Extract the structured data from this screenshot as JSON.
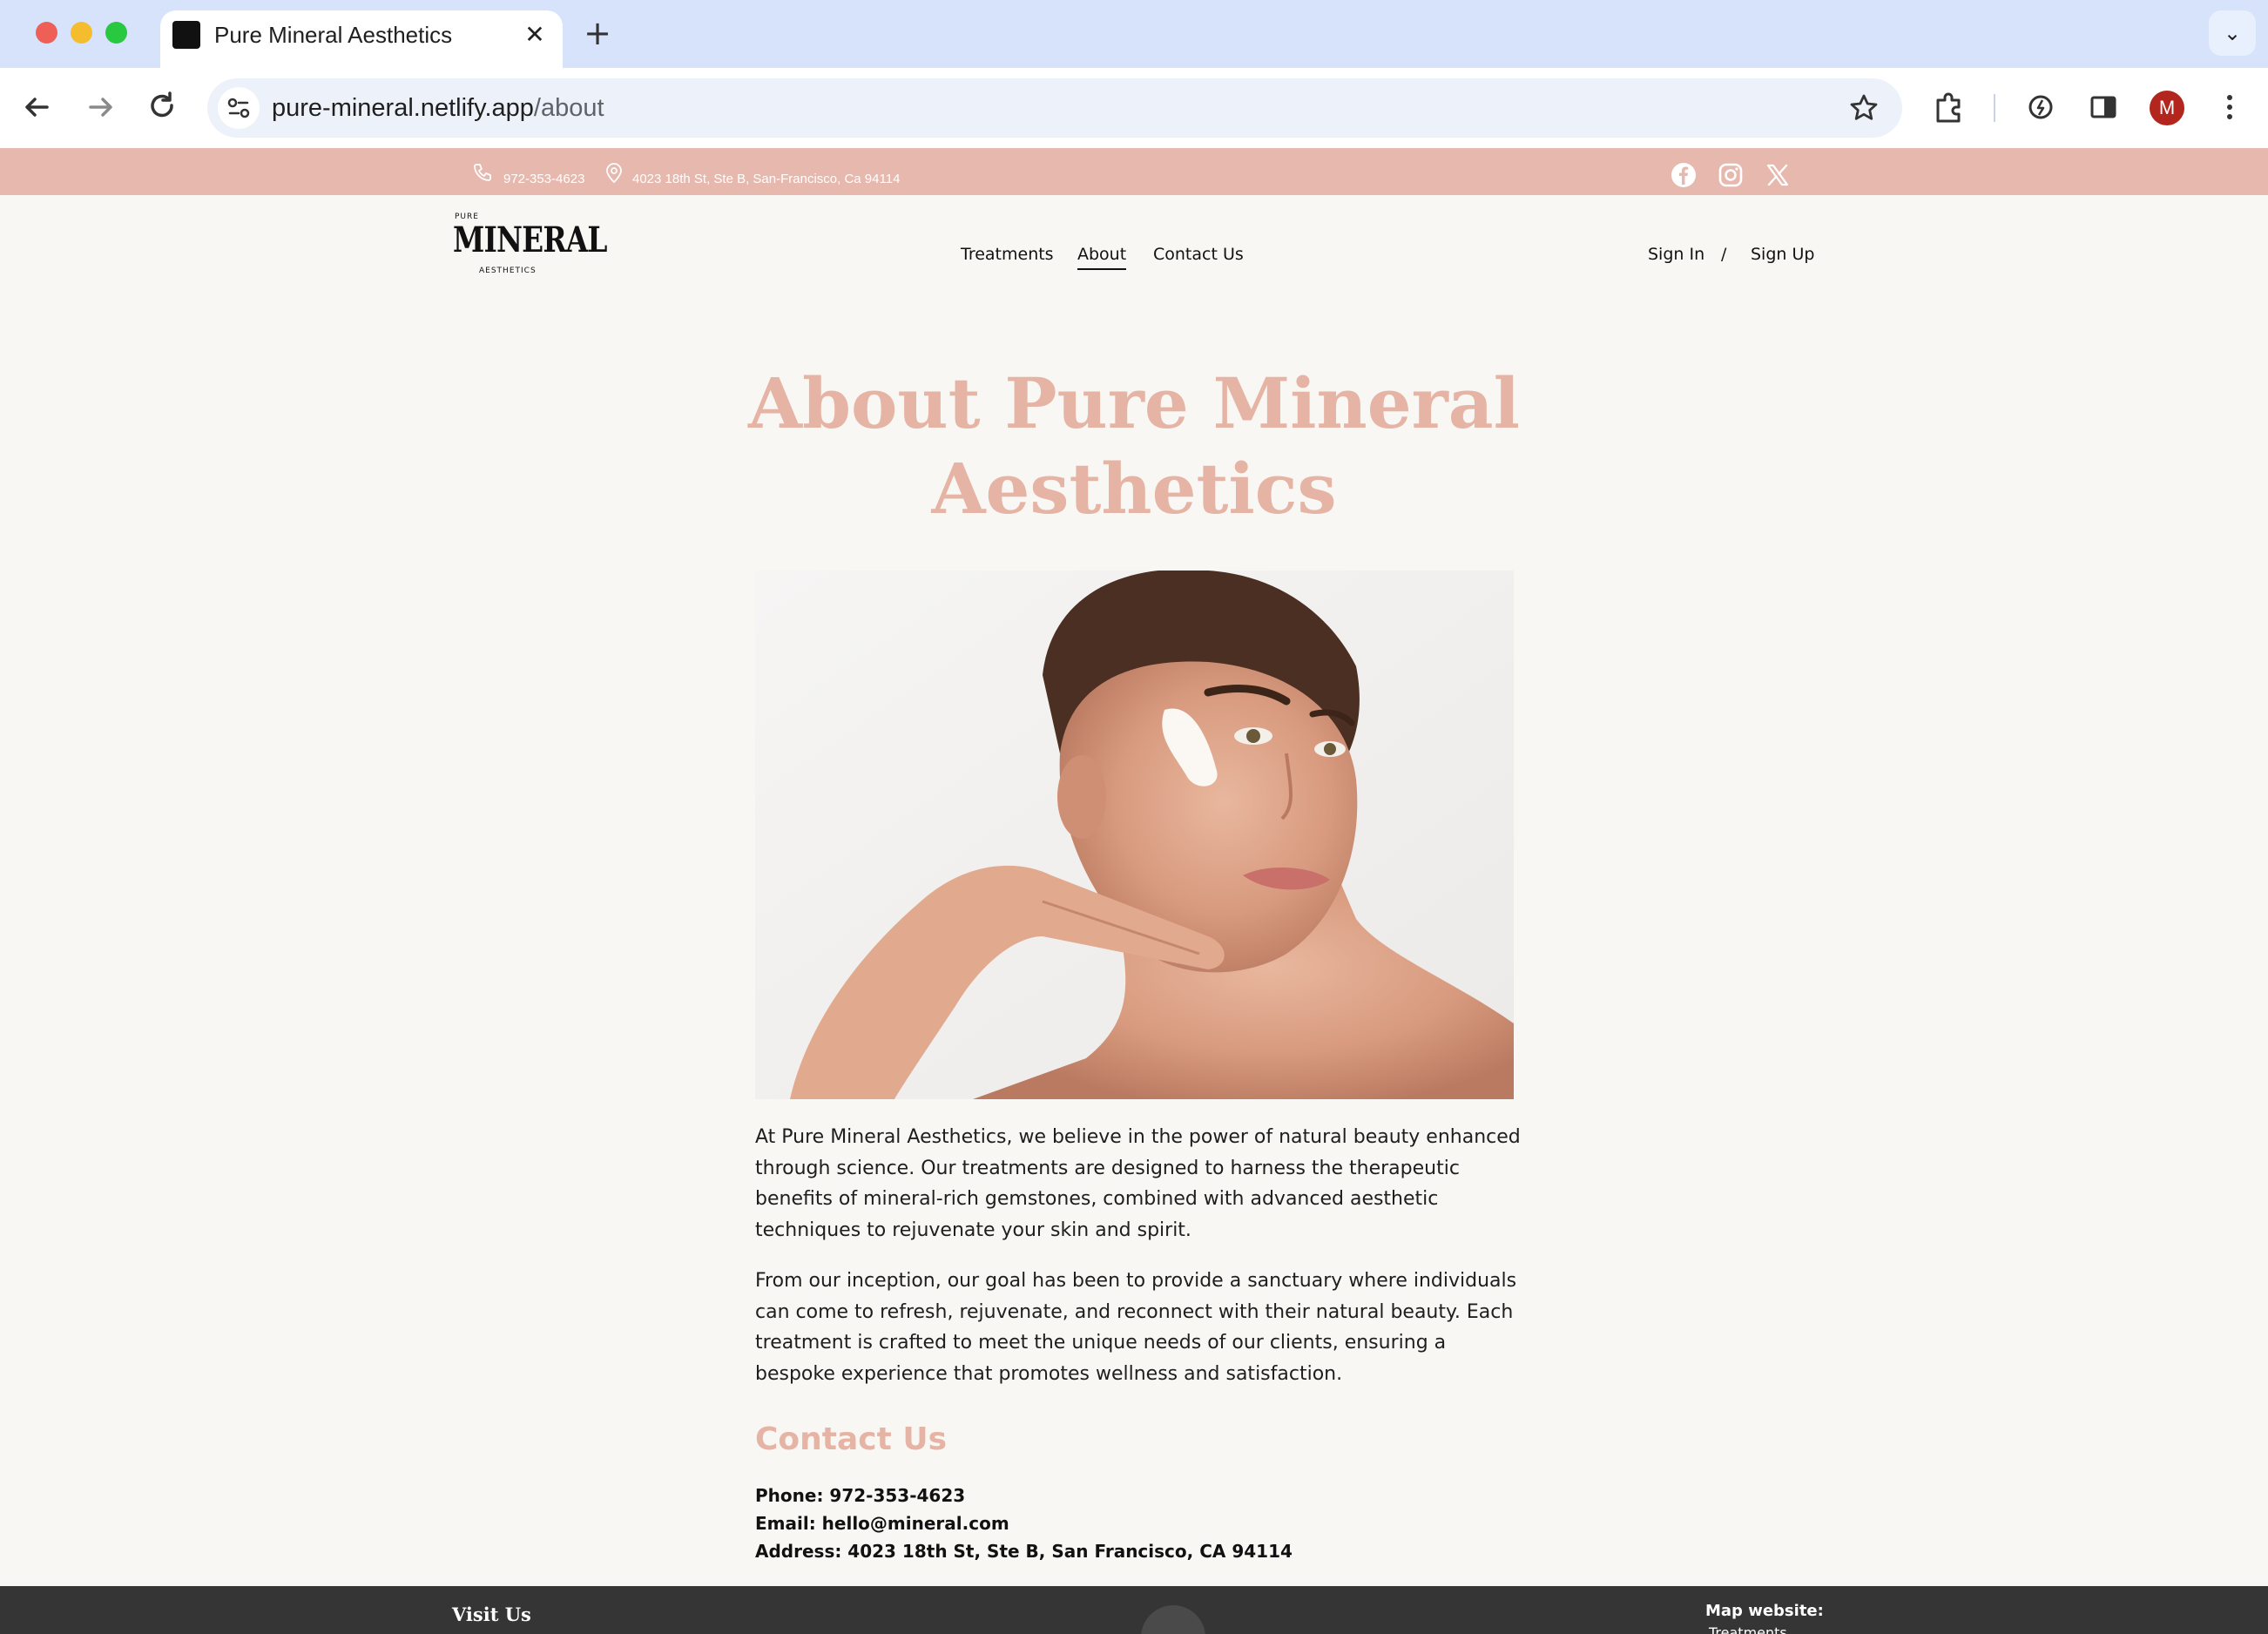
{
  "browser": {
    "tab_title": "Pure Mineral Aesthetics",
    "tab_close": "✕",
    "new_tab": "+",
    "tab_menu": "⌄",
    "url_host": "pure-mineral.netlify.app",
    "url_path": "/about",
    "profile_initial": "M"
  },
  "topbar": {
    "phone": "972-353-4623",
    "address": "4023 18th St, Ste B, San-Francisco, Ca 94114",
    "socials": [
      "facebook-icon",
      "instagram-icon",
      "x-icon"
    ],
    "background": "#e7b8ad"
  },
  "logo": {
    "top": "PURE",
    "main": "MINERAL",
    "bottom": "AESTHETICS"
  },
  "nav": {
    "items": [
      {
        "label": "Treatments",
        "active": false
      },
      {
        "label": "About",
        "active": true
      },
      {
        "label": "Contact Us",
        "active": false
      }
    ],
    "sign_in": "Sign In",
    "separator": "/",
    "sign_up": "Sign Up"
  },
  "main": {
    "title_line1": "About Pure Mineral",
    "title_line2": "Aesthetics",
    "accent_color": "#e6b4a4",
    "paragraph1": "At Pure Mineral Aesthetics, we believe in the power of natural beauty enhanced through science. Our treatments are designed to harness the therapeutic benefits of mineral-rich gemstones, combined with advanced aesthetic techniques to rejuvenate your skin and spirit.",
    "paragraph2": "From our inception, our goal has been to provide a sanctuary where individuals can come to refresh, rejuvenate, and reconnect with their natural beauty. Each treatment is crafted to meet the unique needs of our clients, ensuring a bespoke experience that promotes wellness and satisfaction."
  },
  "contact": {
    "heading": "Contact Us",
    "phone": "Phone: 972-353-4623",
    "email": "Email: hello@mineral.com",
    "address": "Address: 4023 18th St, Ste B, San Francisco, CA 94114"
  },
  "footer": {
    "visit": "Visit Us",
    "map_title": "Map website:",
    "map_first_link": "Treatments",
    "background": "#353535"
  }
}
